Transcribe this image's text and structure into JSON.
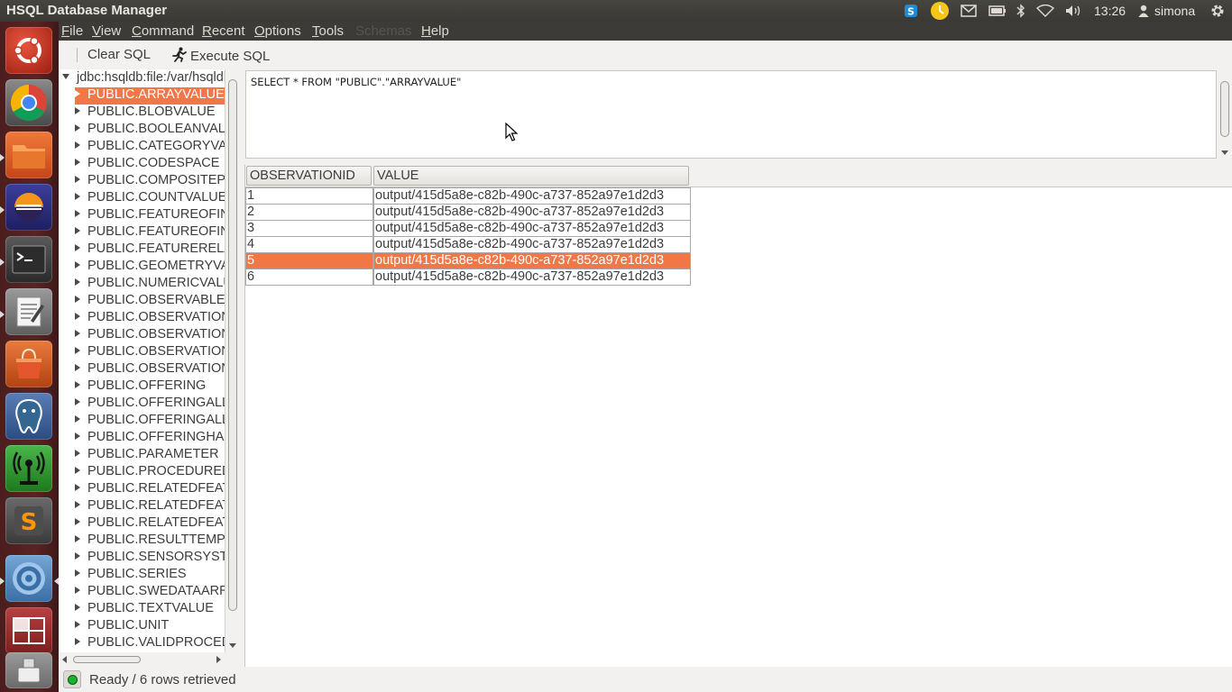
{
  "topbar": {
    "app_title": "HSQL Database Manager",
    "clock": "13:26",
    "user": "simona",
    "tray_icons": [
      "skype-icon",
      "clock-app-icon",
      "mail-icon",
      "battery-icon",
      "bluetooth-icon",
      "wifi-icon",
      "volume-icon",
      "user-icon",
      "gear-icon"
    ]
  },
  "launcher": {
    "items": [
      "ubuntu-dash-icon",
      "chrome-icon",
      "files-icon",
      "eclipse-icon",
      "terminal-icon",
      "text-editor-icon",
      "software-center-icon",
      "postgresql-icon",
      "network-icon",
      "sublime-text-icon",
      "screen-icon",
      "workspace-switcher-icon",
      "usb-drive-icon"
    ]
  },
  "menubar": {
    "items": [
      {
        "label": "File",
        "underline": "F",
        "rest": "ile"
      },
      {
        "label": "View",
        "underline": "V",
        "rest": "iew"
      },
      {
        "label": "Command",
        "underline": "C",
        "rest": "ommand"
      },
      {
        "label": "Recent",
        "underline": "R",
        "rest": "ecent"
      },
      {
        "label": "Options",
        "underline": "O",
        "rest": "ptions"
      },
      {
        "label": "Tools",
        "underline": "T",
        "rest": "ools"
      },
      {
        "label": "Schemas",
        "underline": "",
        "rest": "Schemas"
      },
      {
        "label": "Help",
        "underline": "H",
        "rest": "elp"
      }
    ]
  },
  "toolbar": {
    "clear_label": "Clear SQL",
    "execute_label": "Execute SQL"
  },
  "tree": {
    "root": "jdbc:hsqldb:file:/var/hsqldb",
    "items": [
      "PUBLIC.ARRAYVALUE",
      "PUBLIC.BLOBVALUE",
      "PUBLIC.BOOLEANVALUE",
      "PUBLIC.CATEGORYVALUE",
      "PUBLIC.CODESPACE",
      "PUBLIC.COMPOSITEPHENOMENON",
      "PUBLIC.COUNTVALUE",
      "PUBLIC.FEATUREOFINTEREST",
      "PUBLIC.FEATUREOFINTERESTTYPE",
      "PUBLIC.FEATURERELATION",
      "PUBLIC.GEOMETRYVALUE",
      "PUBLIC.NUMERICVALUE",
      "PUBLIC.OBSERVABLEPROPERTY",
      "PUBLIC.OBSERVATION",
      "PUBLIC.OBSERVATIONCONSTELLATION",
      "PUBLIC.OBSERVATIONHASOFFERING",
      "PUBLIC.OBSERVATIONTYPE",
      "PUBLIC.OFFERING",
      "PUBLIC.OFFERINGALLOWEDFEATURETYPE",
      "PUBLIC.OFFERINGALLOWEDOBSERVATIONTYPE",
      "PUBLIC.OFFERINGHASRELATEDFEATURE",
      "PUBLIC.PARAMETER",
      "PUBLIC.PROCEDUREDESCRIPTIONFORMAT",
      "PUBLIC.RELATEDFEATURE",
      "PUBLIC.RELATEDFEATUREHASROLE",
      "PUBLIC.RELATEDFEATUREROLE",
      "PUBLIC.RESULTTEMPLATE",
      "PUBLIC.SENSORSYSTEM",
      "PUBLIC.SERIES",
      "PUBLIC.SWEDATAARRAYVALUE",
      "PUBLIC.TEXTVALUE",
      "PUBLIC.UNIT",
      "PUBLIC.VALIDPROCEDURETIME"
    ],
    "selected_index": 0
  },
  "sql": {
    "query": "SELECT * FROM \"PUBLIC\".\"ARRAYVALUE\""
  },
  "results": {
    "columns": [
      "OBSERVATIONID",
      "VALUE"
    ],
    "rows": [
      [
        "1",
        "output/415d5a8e-c82b-490c-a737-852a97e1d2d3"
      ],
      [
        "2",
        "output/415d5a8e-c82b-490c-a737-852a97e1d2d3"
      ],
      [
        "3",
        "output/415d5a8e-c82b-490c-a737-852a97e1d2d3"
      ],
      [
        "4",
        "output/415d5a8e-c82b-490c-a737-852a97e1d2d3"
      ],
      [
        "5",
        "output/415d5a8e-c82b-490c-a737-852a97e1d2d3"
      ],
      [
        "6",
        "output/415d5a8e-c82b-490c-a737-852a97e1d2d3"
      ]
    ],
    "selected_row": 4,
    "selection_color": "#f07746"
  },
  "status": {
    "text": "Ready / 6 rows retrieved"
  }
}
